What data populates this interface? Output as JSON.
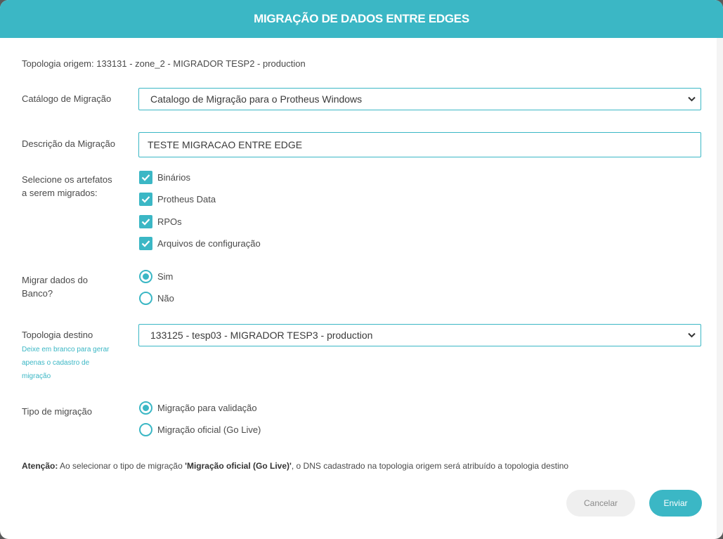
{
  "modal": {
    "title": "MIGRAÇÃO DE DADOS ENTRE EDGES"
  },
  "origin": {
    "text": "Topologia origem: 133131 - zone_2 - MIGRADOR TESP2 - production"
  },
  "catalog": {
    "label": "Catálogo de Migração",
    "selected": "Catalogo de Migração para o Protheus Windows"
  },
  "description": {
    "label": "Descrição da Migração",
    "value": "TESTE MIGRACAO ENTRE EDGE"
  },
  "artifacts": {
    "label_line1": "Selecione os artefatos",
    "label_line2": "a serem migrados:",
    "items": [
      {
        "label": "Binários",
        "checked": true
      },
      {
        "label": "Protheus Data",
        "checked": true
      },
      {
        "label": "RPOs",
        "checked": true
      },
      {
        "label": "Arquivos de configuração",
        "checked": true
      }
    ]
  },
  "database": {
    "label_line1": "Migrar dados do",
    "label_line2": "Banco?",
    "options": [
      {
        "label": "Sim",
        "selected": true
      },
      {
        "label": "Não",
        "selected": false
      }
    ]
  },
  "destination": {
    "label": "Topologia destino",
    "hint_line1": "Deixe em branco para gerar",
    "hint_line2": "apenas o cadastro de",
    "hint_line3": "migração",
    "selected": "133125 - tesp03 - MIGRADOR TESP3 - production"
  },
  "migration_type": {
    "label": "Tipo de migração",
    "options": [
      {
        "label": "Migração para validação",
        "selected": true
      },
      {
        "label": "Migração oficial (Go Live)",
        "selected": false
      }
    ]
  },
  "attention": {
    "prefix": "Atenção:",
    "text1": " Ao selecionar o tipo de migração ",
    "highlight": "'Migração oficial (Go Live)'",
    "text2": ", o DNS cadastrado na topologia origem será atribuído a topologia destino"
  },
  "buttons": {
    "cancel": "Cancelar",
    "send": "Enviar"
  },
  "colors": {
    "accent": "#3bb7c5",
    "text": "#4a4a4a"
  }
}
